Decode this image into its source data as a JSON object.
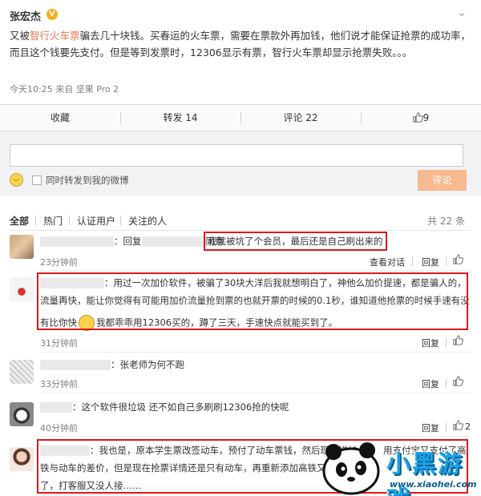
{
  "post": {
    "author": "张宏杰",
    "badge": "V",
    "text_before": "又被",
    "text_highlight": "智行火车票",
    "text_after": "骗去几十块钱。买春运的火车票，需要在票款外再加钱，他们说才能保证抢票的成功率，而且这个钱要先支付。但是等到发票时，12306显示有票，智行火车票却显示抢票失败。。。",
    "meta": "今天10:25 来自 坚果 Pro 2",
    "menu_glyph": "⌄"
  },
  "actions": {
    "favorite": "收藏",
    "repost": "转发 14",
    "comment": "评论 22",
    "like": "9"
  },
  "comment_box": {
    "forward_label": "同时转发到我的微博",
    "submit_label": "评论"
  },
  "tabs": {
    "all": "全部",
    "hot": "热门",
    "verified": "认证用户",
    "following": "关注的人",
    "total": "共 22 条"
  },
  "comments": [
    {
      "prefix": "：回复",
      "suffix": "同意",
      "text": "我就被坑了个会员，最后还是自己刷出来的",
      "time": "23分钟前",
      "view_convo": "查看对话",
      "reply": "回复"
    },
    {
      "line1": "：用过一次加价软件，被骗了30块大洋后我就想明白了，神他么加价提速，都是骗人的，",
      "line2": "流量再快，能让你觉得有可能用加价流量抢到票的也就开票的时候的0.1秒，谁知道他抢票的时候手速有没",
      "line3a": "有比你快",
      "line3b": "我都乖乖用12306买的，蹲了三天，手速快点就能买到了。",
      "time": "31分钟前",
      "reply": "回复"
    },
    {
      "text": "：张老师为何不跑",
      "time": "33分钟前",
      "reply": "回复"
    },
    {
      "text": "：这个软件很垃圾 还不如自己多刷刷12306抢的快呢",
      "time": "40分钟前",
      "reply": "回复",
      "likes": "2"
    },
    {
      "line1a": "：我也是，原本学生票改签动车，预付了动车票钱，然后现在增加",
      "line1b": "用支付宝又支付了高",
      "line2": "铁与动车的差价，但是现在抢票详情还是只有动车，再重新添加高铁又要",
      "line3": "了，打客服又没人接……"
    }
  ],
  "watermark": {
    "title": "小黑游戏",
    "url": "www.xiaohei.com"
  },
  "colors": {
    "highlight": "#eb7350",
    "submit": "#f7b98e",
    "redbox": "#e0181b"
  }
}
